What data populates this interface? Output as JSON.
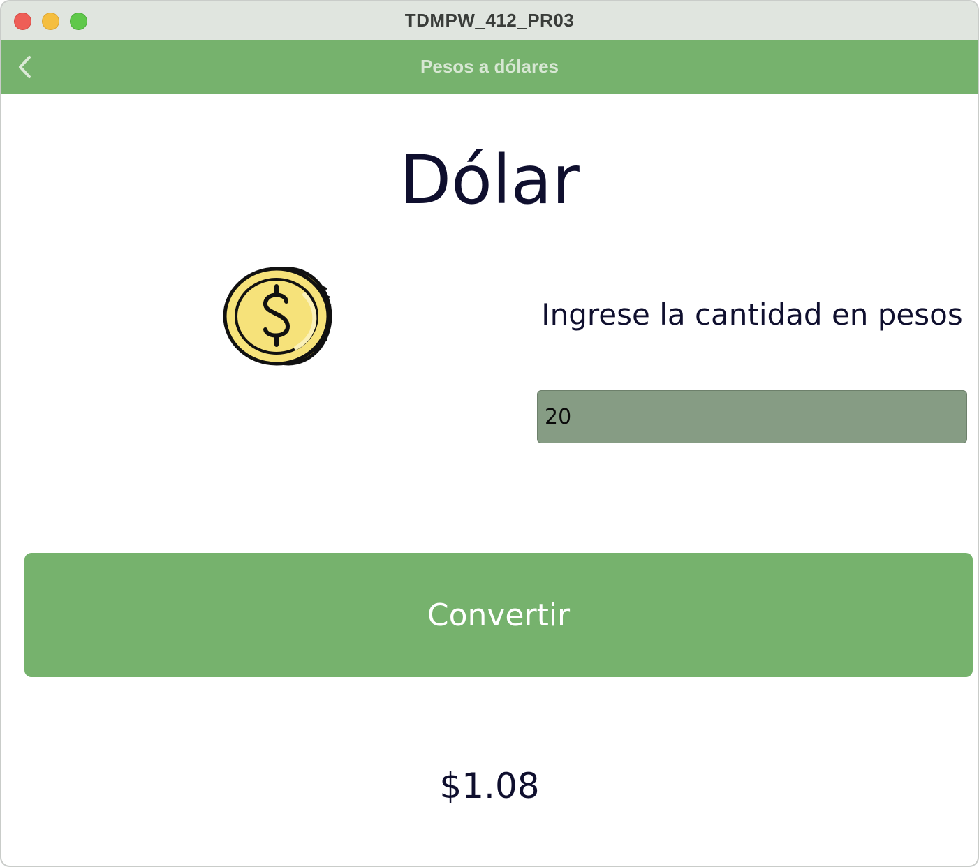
{
  "window": {
    "title": "TDMPW_412_PR03"
  },
  "navbar": {
    "title": "Pesos a dólares",
    "back_icon": "chevron-left-icon"
  },
  "main": {
    "heading": "Dólar",
    "coin_icon": "dollar-coin-icon",
    "prompt_label": "Ingrese la cantidad en pesos",
    "amount_value": "20",
    "convert_label": "Convertir",
    "result": "$1.08"
  },
  "colors": {
    "accent_green": "#76b26d",
    "input_bg": "#869c84",
    "text_dark": "#0f0f2e",
    "coin_gold": "#f6e27a"
  }
}
